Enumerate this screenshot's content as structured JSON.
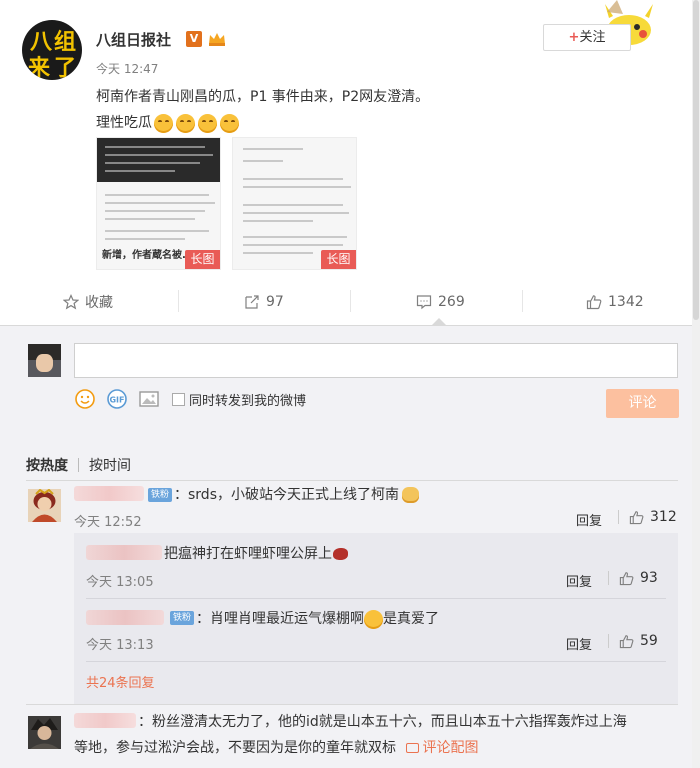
{
  "post": {
    "author": "八组日报社",
    "avatar_text": [
      "八",
      "组",
      "来",
      "了"
    ],
    "time": "今天 12:47",
    "text_line1": "柯南作者青山刚昌的瓜，P1 事件由来，P2网友澄清。",
    "text_line2": "理性吃瓜",
    "follow_label": "关注",
    "follow_plus": "+",
    "images": [
      {
        "caption": "新增，作者蔵名被... ",
        "tag": "长图"
      },
      {
        "caption": "",
        "tag": "长图"
      }
    ]
  },
  "actions": {
    "favorite_label": "收藏",
    "repost_count": "97",
    "comment_count": "269",
    "like_count": "1342"
  },
  "composer": {
    "repost_label": "同时转发到我的微博",
    "submit_label": "评论"
  },
  "sort": {
    "hot_label": "按热度",
    "time_label": "按时间"
  },
  "comments": [
    {
      "tag": "铁粉",
      "text": "：srds，小破站今天正式上线了柯南",
      "time": "今天 12:52",
      "reply_label": "回复",
      "likes": "312",
      "replies": [
        {
          "text": "把瘟神打在虾哩虾哩公屏上",
          "time": "今天 13:05",
          "reply_label": "回复",
          "likes": "93"
        },
        {
          "tag": "铁粉",
          "text": "：肖哩肖哩最近运气爆棚啊",
          "text_tail": "是真爱了",
          "time": "今天 13:13",
          "reply_label": "回复",
          "likes": "59"
        }
      ],
      "more_replies": "共24条回复"
    },
    {
      "text_line1": "：粉丝澄清太无力了，他的id就是山本五十六，而且山本五十六指挥轰炸过上海",
      "text_line2": "等地，参与过淞沪会战，不要因为是你的童年就双标",
      "link_label": "评论配图"
    }
  ]
}
